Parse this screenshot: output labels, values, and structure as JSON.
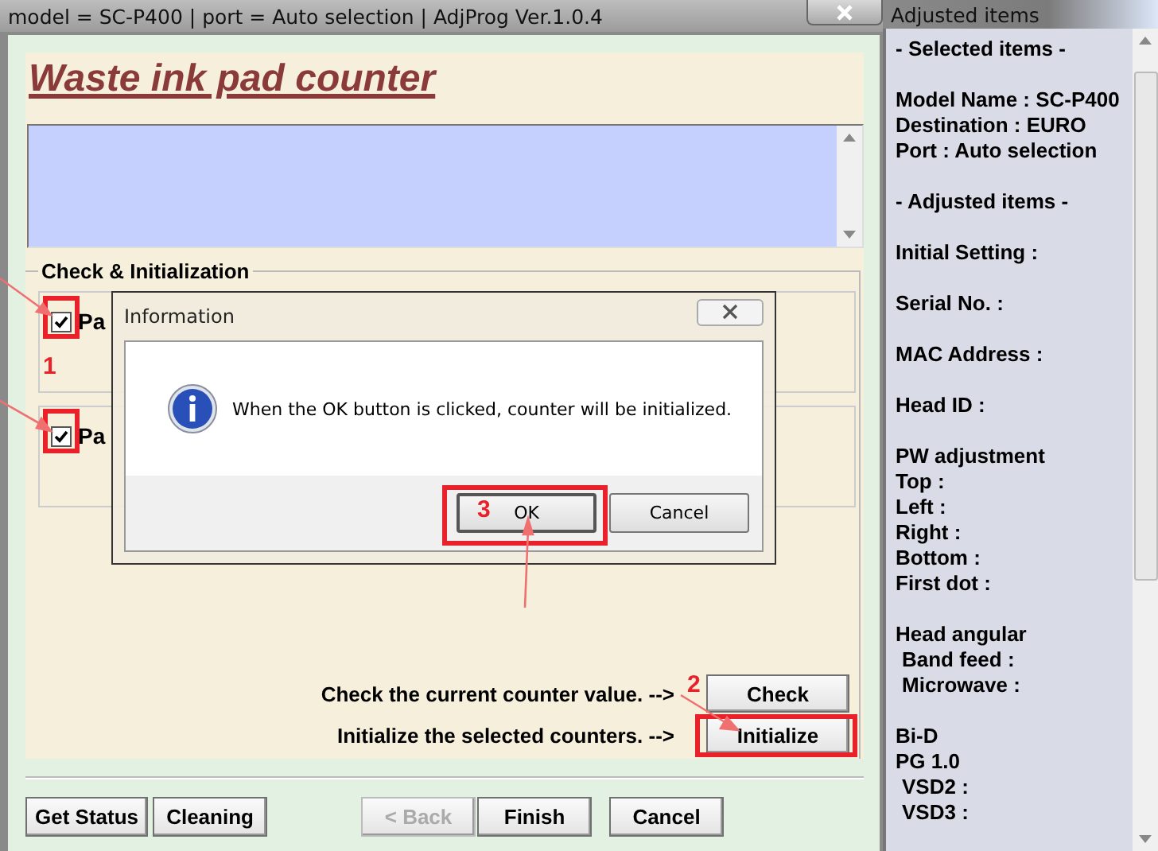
{
  "window": {
    "title": "model = SC-P400 | port = Auto selection | AdjProg Ver.1.0.4"
  },
  "heading": "Waste ink pad counter",
  "group": {
    "title": "Check & Initialization",
    "counters": [
      {
        "label": "Pa",
        "checked": true
      },
      {
        "label": "Pa",
        "checked": true
      }
    ],
    "actions": [
      {
        "caption": "Check the current counter value. -->",
        "button": "Check"
      },
      {
        "caption": "Initialize the selected counters. -->",
        "button": "Initialize"
      }
    ]
  },
  "buttons": [
    {
      "label": "Get Status",
      "disabled": false
    },
    {
      "label": "Cleaning",
      "disabled": false
    },
    {
      "label": "< Back",
      "disabled": true
    },
    {
      "label": "Finish",
      "disabled": false
    },
    {
      "label": "Cancel",
      "disabled": false
    }
  ],
  "side_panel": {
    "title": "Adjusted items",
    "groups": [
      [
        {
          "text": "- Selected items -",
          "indent": false
        }
      ],
      [
        {
          "text": "Model Name : SC-P400",
          "indent": false
        },
        {
          "text": "Destination : EURO",
          "indent": false
        },
        {
          "text": "Port : Auto selection",
          "indent": false
        }
      ],
      [
        {
          "text": "- Adjusted items -",
          "indent": false
        }
      ],
      [
        {
          "text": "Initial Setting :",
          "indent": false
        }
      ],
      [
        {
          "text": "Serial No. :",
          "indent": false
        }
      ],
      [
        {
          "text": "MAC Address :",
          "indent": false
        }
      ],
      [
        {
          "text": "Head ID :",
          "indent": false
        }
      ],
      [
        {
          "text": "PW adjustment",
          "indent": false
        },
        {
          "text": "Top :",
          "indent": false
        },
        {
          "text": "Left :",
          "indent": false
        },
        {
          "text": "Right :",
          "indent": false
        },
        {
          "text": "Bottom :",
          "indent": false
        },
        {
          "text": "First dot :",
          "indent": false
        }
      ],
      [
        {
          "text": "Head angular",
          "indent": false
        },
        {
          "text": "Band feed :",
          "indent": true
        },
        {
          "text": "Microwave :",
          "indent": true
        }
      ],
      [
        {
          "text": "Bi-D",
          "indent": false
        },
        {
          "text": "PG 1.0",
          "indent": false
        },
        {
          "text": "VSD2 :",
          "indent": true
        },
        {
          "text": "VSD3 :",
          "indent": true
        }
      ]
    ]
  },
  "dialog": {
    "title": "Information",
    "message": "When the OK button is clicked, counter will be initialized.",
    "buttons": [
      {
        "label": "OK",
        "default": true
      },
      {
        "label": "Cancel",
        "default": false
      }
    ]
  },
  "annotations": [
    "1",
    "2",
    "3"
  ]
}
